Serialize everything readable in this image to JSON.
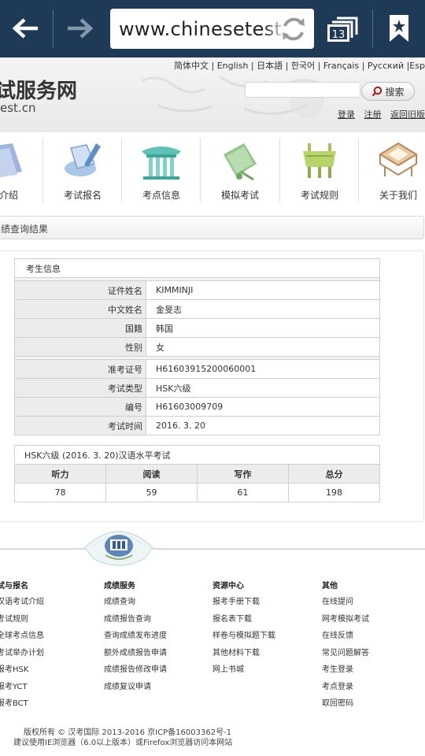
{
  "browser": {
    "url": "www.chinesetest",
    "tab_count": "13",
    "colors": {
      "toolbar": "#1f3a57"
    }
  },
  "header": {
    "languages": "简体中文 | English | 日本語 | 한국어 | Français | Русский |Español",
    "logo_main": "试服务网",
    "logo_sub": "est.cn",
    "search_button": "搜索",
    "search_placeholder": "",
    "links": {
      "login": "登录",
      "register": "注册",
      "old_version": "返回旧版"
    }
  },
  "nav": {
    "items": [
      {
        "label": "试介绍",
        "icon": "book-icon"
      },
      {
        "label": "考试报名",
        "icon": "pen-registration-icon"
      },
      {
        "label": "考点信息",
        "icon": "temple-icon"
      },
      {
        "label": "模拟考试",
        "icon": "scroll-icon"
      },
      {
        "label": "考试规则",
        "icon": "bronze-vessel-icon"
      },
      {
        "label": "关于我们",
        "icon": "box-icon"
      }
    ]
  },
  "section": {
    "title": "绩查询结果"
  },
  "candidate": {
    "caption": "考生信息",
    "rows": [
      {
        "label": "证件姓名",
        "value": "KIMMINJI"
      },
      {
        "label": "中文姓名",
        "value": "金旻志"
      },
      {
        "label": "国籍",
        "value": "韩国"
      },
      {
        "label": "性别",
        "value": "女"
      },
      {
        "label": "准考证号",
        "value": "H61603915200060001"
      },
      {
        "label": "考试类型",
        "value": "HSK六级"
      },
      {
        "label": "编号",
        "value": "H61603009709"
      },
      {
        "label": "考试时间",
        "value": "2016. 3. 20"
      }
    ]
  },
  "scores": {
    "caption": "HSK六级 (2016. 3. 20)汉语水平考试",
    "headers": [
      "听力",
      "阅读",
      "写作",
      "总分"
    ],
    "values": [
      "78",
      "59",
      "61",
      "198"
    ]
  },
  "footer": {
    "columns": [
      {
        "heading": "试与报名",
        "items": [
          "汉语考试介绍",
          "考试规则",
          "全球考点信息",
          "考试举办计划",
          "报考HSK",
          "报考YCT",
          "报考BCT"
        ]
      },
      {
        "heading": "成绩服务",
        "items": [
          "成绩查询",
          "成绩报告查询",
          "查询成绩发布进度",
          "额外成绩报告申请",
          "成绩报告修改申请",
          "成绩复议申请"
        ]
      },
      {
        "heading": "资源中心",
        "items": [
          "报考手册下载",
          "报名表下载",
          "样卷与模拟题下载",
          "其他材料下载",
          "网上书城"
        ]
      },
      {
        "heading": "其他",
        "items": [
          "在线提问",
          "网考模拟考试",
          "在线反馈",
          "常见问题解答",
          "考生登录",
          "考点登录",
          "取回密码"
        ]
      }
    ],
    "copyright": "版权所有 © 汉考国际 2013-2016  京ICP备16003362号-1",
    "browser_note": "建议使用IE浏览器（6.0以上版本）或Firefox浏览器访问本网站"
  }
}
